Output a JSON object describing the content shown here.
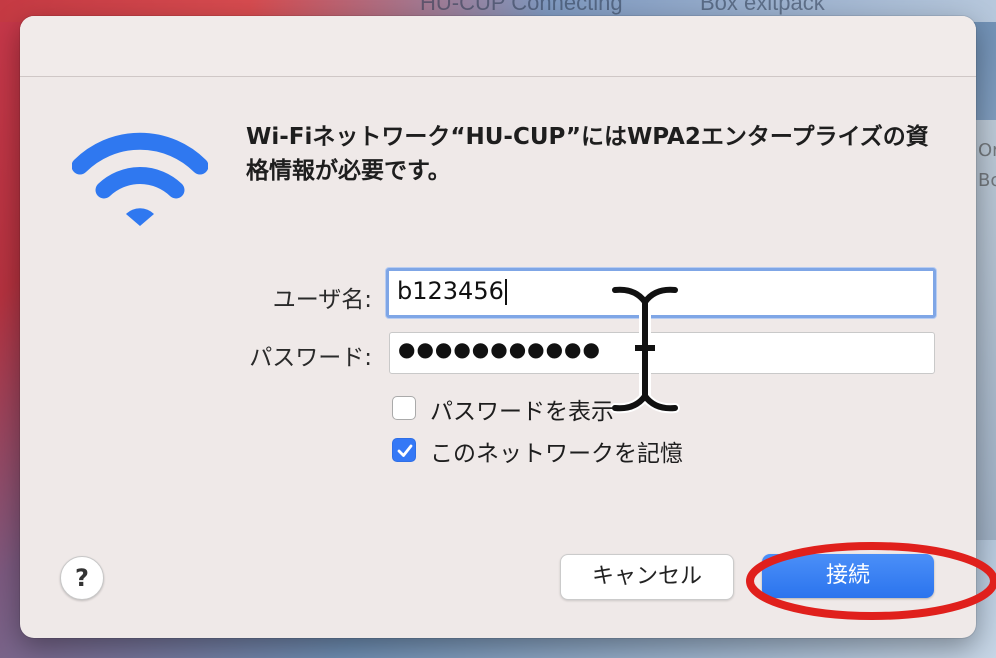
{
  "background": {
    "top_text_left": "HU-CUP Connecting",
    "top_text_right": "Box  exitpack",
    "right_text_1": "Or",
    "right_text_2": "Bo"
  },
  "dialog": {
    "message": "Wi-Fiネットワーク“HU-CUP”にはWPA2エンタープライズの資格情報が必要です。",
    "username_label": "ユーザ名:",
    "username_value": "b123456",
    "password_label": "パスワード:",
    "password_value": "●●●●●●●●●●●",
    "show_password_label": "パスワードを表示",
    "remember_network_label": "このネットワークを記憶",
    "help_label": "?",
    "cancel_label": "キャンセル",
    "connect_label": "接続"
  },
  "state": {
    "show_password_checked": false,
    "remember_network_checked": true
  },
  "colors": {
    "accent": "#3478f6",
    "wifi_icon": "#2f78f0",
    "highlight": "#e0201c"
  }
}
